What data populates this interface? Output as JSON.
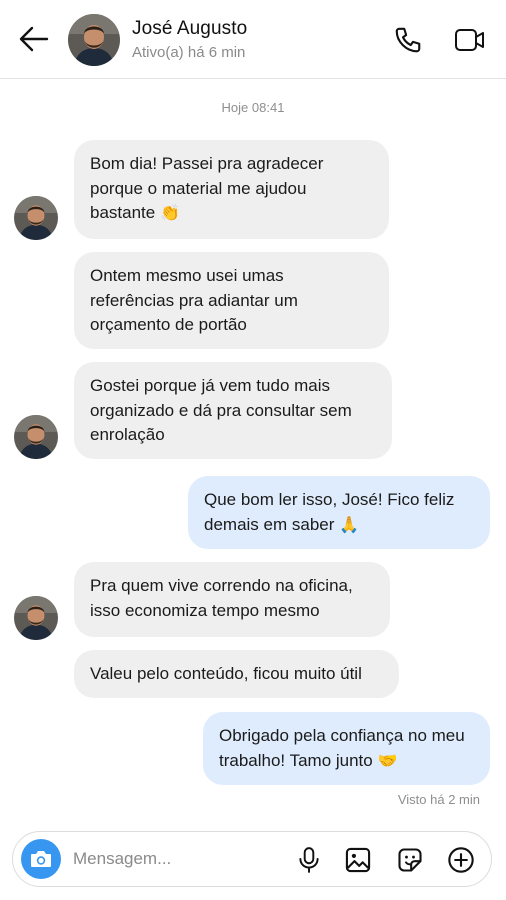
{
  "header": {
    "name": "José Augusto",
    "status": "Ativo(a) há 6 min",
    "back_icon": "arrow-left-icon",
    "call_icon": "phone-icon",
    "video_icon": "video-camera-icon"
  },
  "day_stamp": "Hoje 08:41",
  "messages": [
    {
      "side": "in",
      "text": "Bom dia! Passei pra agradecer\nporque o material me ajudou\nbastante",
      "emoji": "👏"
    },
    {
      "side": "in",
      "text": "Ontem mesmo usei umas\nreferências pra adiantar um\norçamento de portão",
      "emoji": ""
    },
    {
      "side": "in",
      "text": "Gostei porque já vem tudo mais\norganizado e dá pra consultar sem\nenrolação",
      "emoji": ""
    },
    {
      "side": "out",
      "text": "Que bom ler isso, José! Fico feliz\ndemais em saber",
      "emoji": "🙏"
    },
    {
      "side": "in",
      "text": "Pra quem vive correndo na oficina,\nisso economiza tempo mesmo",
      "emoji": ""
    },
    {
      "side": "in",
      "text": "Valeu pelo conteúdo, ficou muito útil",
      "emoji": ""
    },
    {
      "side": "out",
      "text": "Obrigado pela confiança no meu\ntrabalho! Tamo junto",
      "emoji": "🤝"
    }
  ],
  "seen_status": "Visto há 2 min",
  "composer": {
    "placeholder": "Mensagem...",
    "camera_icon": "camera-icon",
    "mic_icon": "microphone-icon",
    "gallery_icon": "image-icon",
    "sticker_icon": "sticker-icon",
    "add_icon": "plus-circle-icon"
  },
  "colors": {
    "incoming_bubble": "#efefef",
    "outgoing_bubble": "#dfecfd",
    "accent": "#3797f0"
  }
}
